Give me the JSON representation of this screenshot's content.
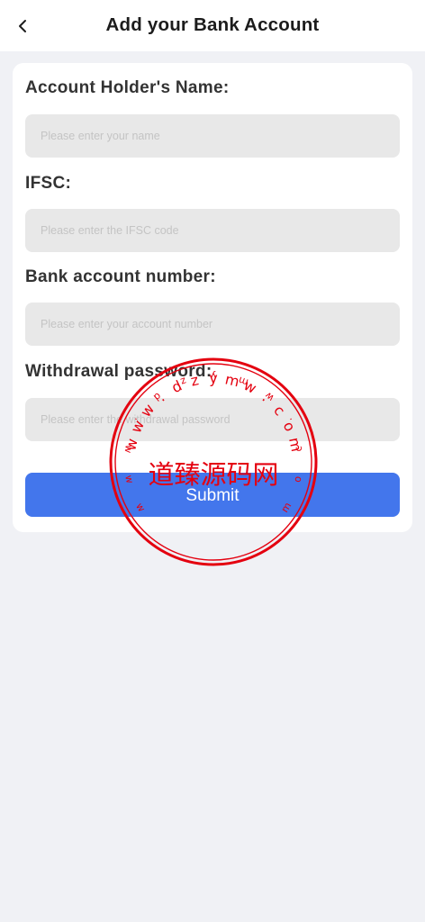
{
  "header": {
    "back_icon": "chevron-left-icon",
    "title": "Add your Bank Account"
  },
  "form": {
    "holder_name": {
      "label": "Account Holder's Name:",
      "placeholder": "Please enter your name",
      "value": ""
    },
    "ifsc": {
      "label": "IFSC:",
      "placeholder": "Please enter the IFSC code",
      "value": ""
    },
    "account_number": {
      "label": "Bank account number:",
      "placeholder": "Please enter your account number",
      "value": ""
    },
    "withdrawal_password": {
      "label": "Withdrawal password:",
      "placeholder": "Please enter the withdrawal password",
      "value": ""
    },
    "submit_label": "Submit"
  },
  "watermark": {
    "center_text": "道臻源码网",
    "ring_text": "www.dzymw.com",
    "color": "#e4000f"
  },
  "colors": {
    "background": "#f0f1f5",
    "card": "#ffffff",
    "input_background": "#e8e8e8",
    "button": "#4376ec",
    "label_text": "#333333"
  }
}
